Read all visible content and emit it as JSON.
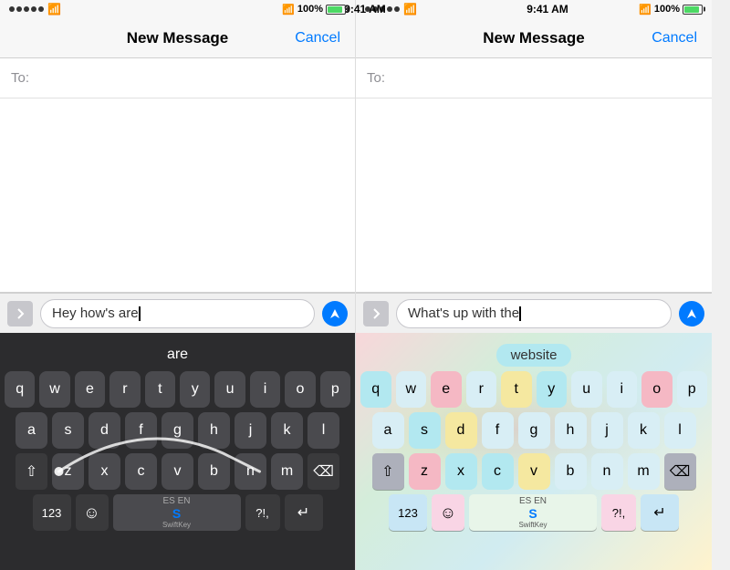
{
  "left_phone": {
    "status_bar": {
      "time": "9:41 AM",
      "battery": "100%"
    },
    "nav": {
      "title": "New Message",
      "cancel": "Cancel"
    },
    "to_label": "To:",
    "message_input": "Hey how's are",
    "prediction": "are",
    "keyboard_theme": "dark",
    "keys_row1": [
      "q",
      "w",
      "e",
      "r",
      "t",
      "y",
      "u",
      "i",
      "o",
      "p"
    ],
    "keys_row2": [
      "a",
      "s",
      "d",
      "f",
      "g",
      "h",
      "j",
      "k",
      "l"
    ],
    "keys_row3": [
      "z",
      "x",
      "c",
      "v",
      "b",
      "n",
      "m"
    ],
    "space_label": "ES EN",
    "swiftkey_label": "SwiftKey",
    "numbers_label": "123",
    "punctuation_label": "?!,"
  },
  "right_phone": {
    "status_bar": {
      "time": "9:41 AM",
      "battery": "100%"
    },
    "nav": {
      "title": "New Message",
      "cancel": "Cancel"
    },
    "to_label": "To:",
    "message_input": "What's up with the",
    "prediction": "website",
    "keyboard_theme": "light_colorful",
    "keys_row1": [
      "q",
      "w",
      "e",
      "r",
      "t",
      "y",
      "u",
      "i",
      "o",
      "p"
    ],
    "keys_row2": [
      "a",
      "s",
      "d",
      "f",
      "g",
      "h",
      "j",
      "k",
      "l"
    ],
    "keys_row3": [
      "z",
      "x",
      "c",
      "v",
      "b",
      "n",
      "m"
    ],
    "space_label": "ES EN",
    "swiftkey_label": "SwiftKey",
    "numbers_label": "123",
    "punctuation_label": "?!,"
  }
}
